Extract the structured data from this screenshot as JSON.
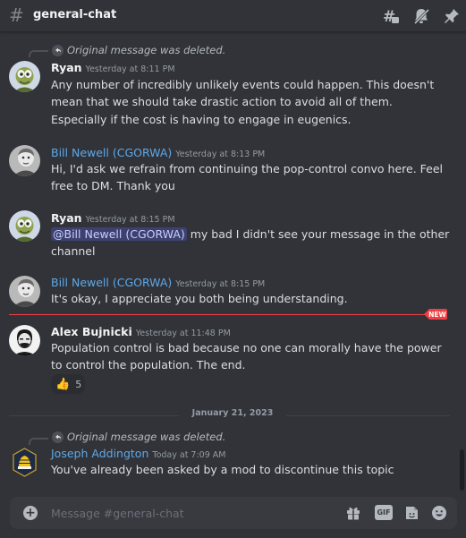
{
  "header": {
    "channel_name": "general-chat"
  },
  "messages": [
    {
      "reply_text": "Original message was deleted.",
      "author": "Ryan",
      "author_color": "#f2f3f5",
      "timestamp": "Yesterday at 8:11 PM",
      "avatar_icon": "ryan-avatar",
      "lines": [
        "Any number of incredibly unlikely events could happen. This doesn't mean that we should take drastic action to avoid all of them.",
        "Especially if the cost is having to engage in eugenics."
      ]
    },
    {
      "author": "Bill Newell (CGORWA)",
      "author_color": "#5fa8e8",
      "timestamp": "Yesterday at 8:13 PM",
      "avatar_icon": "bill-avatar",
      "lines": [
        "Hi, I'd ask we refrain from continuing the pop-control convo here. Feel free to DM. Thank you"
      ]
    },
    {
      "author": "Ryan",
      "author_color": "#f2f3f5",
      "timestamp": "Yesterday at 8:15 PM",
      "avatar_icon": "ryan-avatar",
      "mention": "@Bill Newell (CGORWA)",
      "lines": [
        " my bad I didn't see your message in the other channel"
      ]
    },
    {
      "author": "Bill Newell (CGORWA)",
      "author_color": "#5fa8e8",
      "timestamp": "Yesterday at 8:15 PM",
      "avatar_icon": "bill-avatar",
      "lines": [
        "It's okay, I appreciate you both being understanding."
      ]
    },
    {
      "author": "Alex Bujnicki",
      "author_color": "#f2f3f5",
      "timestamp": "Yesterday at 11:48 PM",
      "avatar_icon": "alex-avatar",
      "lines": [
        "Population control is bad because no one can morally have the power to control the population. The end."
      ],
      "reaction": {
        "emoji": "👍",
        "count": "5"
      }
    },
    {
      "reply_text": "Original message was deleted.",
      "author": "Joseph Addington",
      "author_color": "#5fa8e8",
      "timestamp": "Today at 7:09 AM",
      "avatar_icon": "joseph-avatar",
      "lines": [
        "You've already been asked by a mod to discontinue this topic"
      ]
    }
  ],
  "new_badge": "NEW",
  "date_divider": "January 21, 2023",
  "composer": {
    "placeholder": "Message #general-chat",
    "gif_label": "GIF"
  },
  "colors": {
    "background": "#313338",
    "mention_bg": "#3c4270",
    "new_red": "#f23f43",
    "link_blue": "#5fa8e8"
  }
}
